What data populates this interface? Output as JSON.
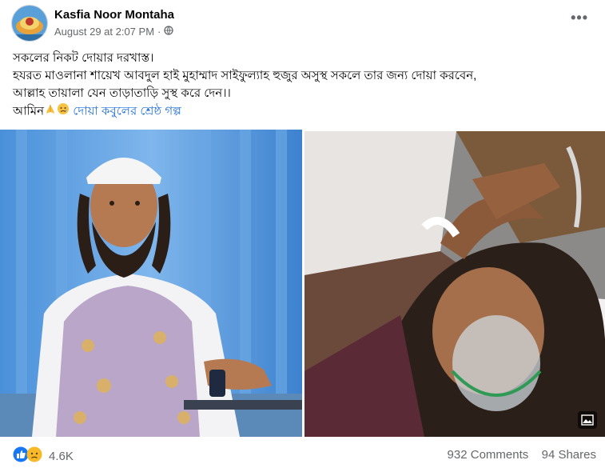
{
  "post": {
    "author": "Kasfia Noor Montaha",
    "timestamp": "August 29 at 2:07 PM",
    "separator": "·",
    "audience_icon": "globe-icon",
    "more_label": "•••",
    "lines": [
      "সকলের নিকট দোয়ার দরখাস্ত।",
      "হযরত মাওলানা শায়েখ আবদুল হাই মুহাম্মাদ সাইফুল্যাহ হুজুর অসুস্থ সকলে তার  জন্য দোয়া করবেন,",
      "আল্লাহ তায়ালা যেন তাড়াতাড়ি সুস্থ করে দেন।।"
    ],
    "last_line_prefix": "আমিন",
    "page_link": "দোয়া কবুলের শ্রেষ্ঠ গল্প"
  },
  "engagement": {
    "reaction_count": "4.6K",
    "comments": "932 Comments",
    "shares": "94 Shares"
  },
  "colors": {
    "link": "#216fdb",
    "secondary_text": "#65676b",
    "like_blue": "#1877f2",
    "sad_yellow": "#f7b928"
  }
}
